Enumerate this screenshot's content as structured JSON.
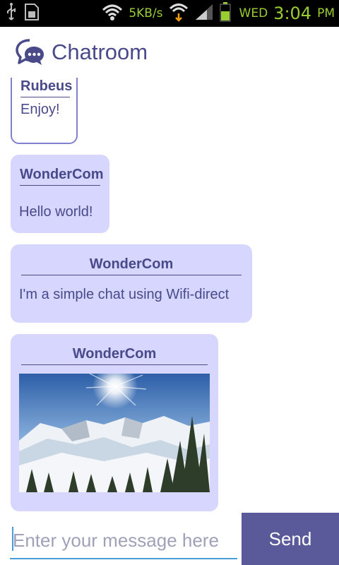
{
  "status_bar": {
    "network_speed": "5KB/s",
    "day": "WED",
    "time": "3:04",
    "ampm": "PM",
    "icons": [
      "usb-icon",
      "sd-card-icon",
      "wifi-icon",
      "wifi-data-icon",
      "signal-icon",
      "battery-icon"
    ]
  },
  "app": {
    "title": "Chatroom",
    "logo_icon": "chat-bubbles-icon"
  },
  "messages": [
    {
      "sender": "Rubeus",
      "text": "Enjoy!"
    },
    {
      "sender": "WonderCom",
      "text": "Hello world!"
    },
    {
      "sender": "WonderCom",
      "text": "I'm a simple chat using Wifi-direct"
    },
    {
      "sender": "WonderCom",
      "image": "snowy-mountain-photo"
    }
  ],
  "input": {
    "placeholder": "Enter your message here",
    "value": "",
    "send_label": "Send"
  },
  "colors": {
    "accent": "#4a4a8a",
    "bubble": "#d6d6ff",
    "send_button": "#5a5a9a",
    "status_text": "#9acd32"
  }
}
